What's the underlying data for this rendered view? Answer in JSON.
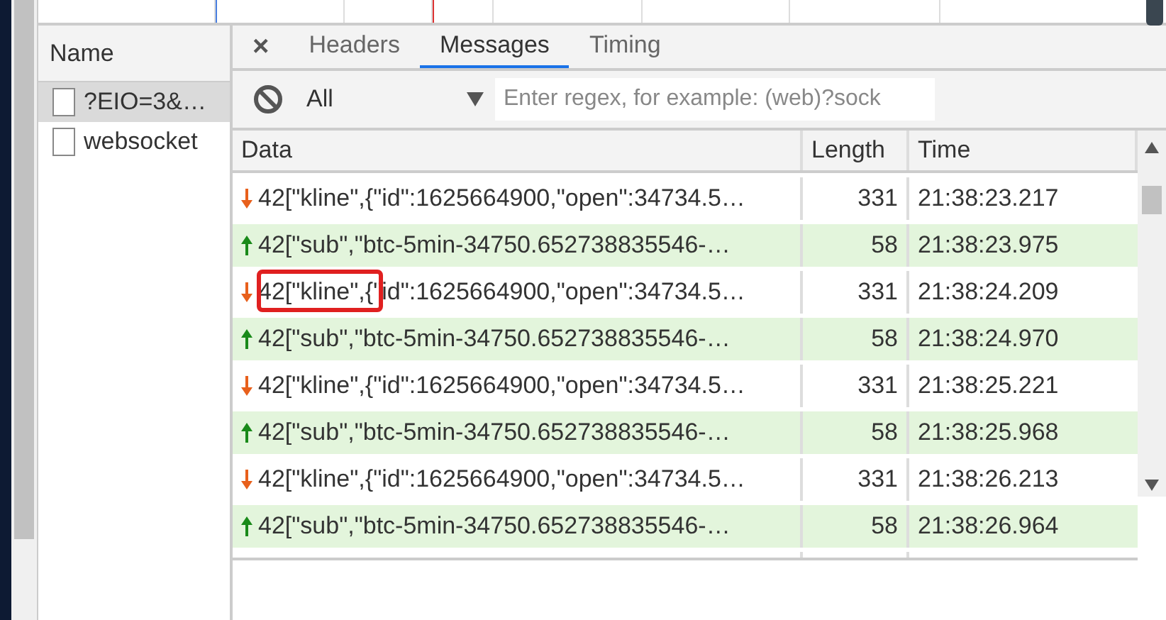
{
  "requests": {
    "header": "Name",
    "items": [
      {
        "name": "?EIO=3&…",
        "selected": true
      },
      {
        "name": "websocket",
        "selected": false
      }
    ]
  },
  "tabs": [
    {
      "label": "Headers",
      "selected": false
    },
    {
      "label": "Messages",
      "selected": true
    },
    {
      "label": "Timing",
      "selected": false
    }
  ],
  "close_tab": "×",
  "filter": {
    "type": "All",
    "placeholder": "Enter regex, for example: (web)?sock"
  },
  "table": {
    "columns": [
      "Data",
      "Length",
      "Time"
    ],
    "rows": [
      {
        "kind": "received",
        "data": "42[\"kline\",{\"id\":1625664900,\"open\":34734.5…",
        "length": "331",
        "time": "21:38:23.217",
        "highlight": false
      },
      {
        "kind": "sent",
        "data": "42[\"sub\",\"btc-5min-34750.652738835546-…",
        "length": "58",
        "time": "21:38:23.975",
        "highlight": false
      },
      {
        "kind": "received",
        "data": "42[\"kline\",{\"id\":1625664900,\"open\":34734.5…",
        "length": "331",
        "time": "21:38:24.209",
        "highlight": true
      },
      {
        "kind": "sent",
        "data": "42[\"sub\",\"btc-5min-34750.652738835546-…",
        "length": "58",
        "time": "21:38:24.970",
        "highlight": false
      },
      {
        "kind": "received",
        "data": "42[\"kline\",{\"id\":1625664900,\"open\":34734.5…",
        "length": "331",
        "time": "21:38:25.221",
        "highlight": false
      },
      {
        "kind": "sent",
        "data": "42[\"sub\",\"btc-5min-34750.652738835546-…",
        "length": "58",
        "time": "21:38:25.968",
        "highlight": false
      },
      {
        "kind": "received",
        "data": "42[\"kline\",{\"id\":1625664900,\"open\":34734.5…",
        "length": "331",
        "time": "21:38:26.213",
        "highlight": false
      },
      {
        "kind": "sent",
        "data": "42[\"sub\",\"btc-5min-34750.652738835546-…",
        "length": "58",
        "time": "21:38:26.964",
        "highlight": false
      }
    ]
  }
}
